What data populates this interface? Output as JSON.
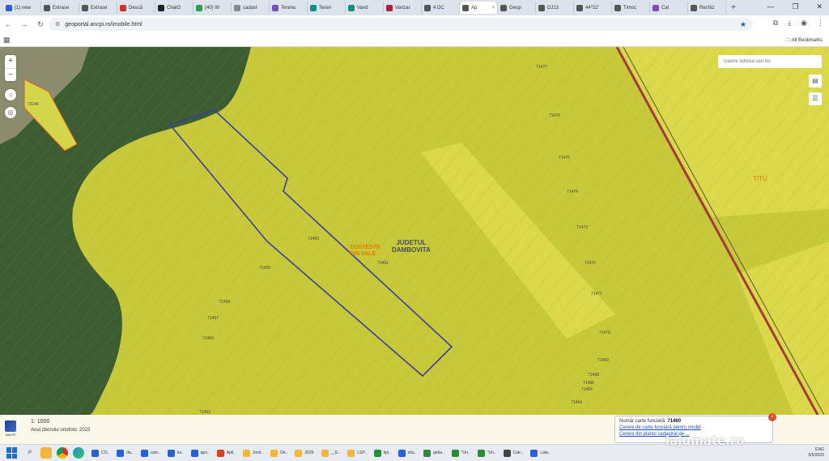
{
  "browser": {
    "tabs": [
      {
        "label": "(1) new",
        "color": "#2b5fd9"
      },
      {
        "label": "Extrase",
        "color": "#555555"
      },
      {
        "label": "Extrase",
        "color": "#555555"
      },
      {
        "label": "Descă",
        "color": "#d32f2f"
      },
      {
        "label": "ChatG",
        "color": "#222222"
      },
      {
        "label": "(40) W",
        "color": "#2e9e4a"
      },
      {
        "label": "cadast",
        "color": "#888888"
      },
      {
        "label": "Terenu",
        "color": "#7b4bc9"
      },
      {
        "label": "Teren",
        "color": "#0e8f86"
      },
      {
        "label": "Vand",
        "color": "#0e8f86"
      },
      {
        "label": "Vanzar",
        "color": "#b3203b"
      },
      {
        "label": "4 DC",
        "color": "#555555"
      },
      {
        "label": "Ap",
        "color": "#555555",
        "active": true
      },
      {
        "label": "Geop",
        "color": "#555555"
      },
      {
        "label": "DJ13",
        "color": "#555555"
      },
      {
        "label": "44°52'",
        "color": "#555555"
      },
      {
        "label": "Timoc",
        "color": "#555555"
      },
      {
        "label": "Cal",
        "color": "#7b4bc9"
      },
      {
        "label": "Rechiz",
        "color": "#555555"
      }
    ],
    "new_tab": "+",
    "url": "geoportal.ancpi.ro/imobile.html",
    "all_bookmarks": "All Bookmarks"
  },
  "map": {
    "search_placeholder": "Găsire adresă sau loc",
    "zoom_in": "+",
    "zoom_out": "−",
    "parcel_labels": [
      {
        "text": "71477"
      },
      {
        "text": "71476"
      },
      {
        "text": "71475"
      },
      {
        "text": "71474"
      },
      {
        "text": "71473"
      },
      {
        "text": "71472"
      },
      {
        "text": "71471"
      },
      {
        "text": "71470"
      },
      {
        "text": "71469"
      },
      {
        "text": "71468"
      },
      {
        "text": "71465"
      },
      {
        "text": "71464"
      },
      {
        "text": "71460"
      },
      {
        "text": "71461"
      },
      {
        "text": "71459"
      },
      {
        "text": "71458"
      },
      {
        "text": "71457"
      },
      {
        "text": "71456"
      },
      {
        "text": "71463"
      },
      {
        "text": "73140"
      },
      {
        "text": "71466"
      }
    ],
    "county_label": [
      "JUDETUL",
      "DAMBOVITA"
    ],
    "village_label": [
      "COSTESTII",
      "DIN VALE"
    ],
    "titu_label": "TITU",
    "colors": {
      "field": "#c7c83a",
      "field_light": "#d3d64a",
      "field_bright": "#dcd84b",
      "forest": "#3c5c31",
      "parcel_outline": "#3b3f9e",
      "road": "#a23b3b"
    }
  },
  "status": {
    "scale": "1: 1000",
    "orto_year": "Anul zborului ortofoto: 2023",
    "ancpi_text": "ANCPI"
  },
  "popup": {
    "cf_label": "Număr carte funciară:",
    "cf_number": "71460",
    "link1": "Cerere de carte funciară pentru imobil",
    "link2": "Cerere din planul cadastral de ..."
  },
  "taskbar": {
    "items": [
      {
        "label": "CO..",
        "color": "#2b5fd9"
      },
      {
        "label": "da..",
        "color": "#2b5fd9"
      },
      {
        "label": "cam..",
        "color": "#2b5fd9"
      },
      {
        "label": "lui..",
        "color": "#2b5fd9"
      },
      {
        "label": "apo..",
        "color": "#2b5fd9"
      },
      {
        "label": "Apli..",
        "color": "#d04423"
      },
      {
        "label": "Jonit..",
        "color": "#f2b73a"
      },
      {
        "label": "De..",
        "color": "#f2b73a"
      },
      {
        "label": "2025",
        "color": "#f2b73a"
      },
      {
        "label": "__E..",
        "color": "#f2b73a"
      },
      {
        "label": "LSP..",
        "color": "#f2b73a"
      },
      {
        "label": "lipi..",
        "color": "#2b8a3e"
      },
      {
        "label": "situ..",
        "color": "#2b5fd9"
      },
      {
        "label": "gelia..",
        "color": "#2b8a3e"
      },
      {
        "label": "\"Un..",
        "color": "#2b8a3e"
      },
      {
        "label": "\"Un..",
        "color": "#2b8a3e"
      },
      {
        "label": "Calc..",
        "color": "#444444"
      },
      {
        "label": "Lala..",
        "color": "#2b5fd9"
      }
    ],
    "tray": {
      "lang": "ENG",
      "date": "6/5/2025"
    }
  },
  "watermark": "lajumate.ro"
}
